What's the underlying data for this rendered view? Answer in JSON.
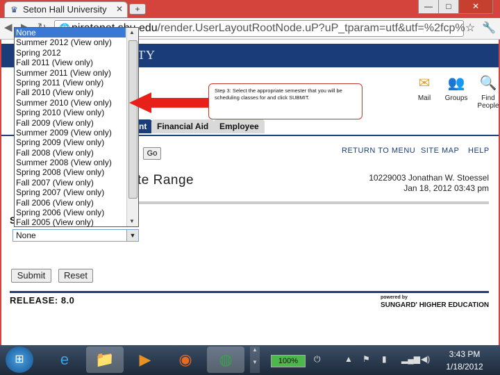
{
  "browser": {
    "tab_title": "Seton Hall University",
    "tab_close": "✕",
    "new_tab": "+",
    "window_controls": {
      "minimize": "—",
      "maximize": "□",
      "close": "✕"
    },
    "address": {
      "host_part": "piratenet.shu.edu",
      "path_part": "/render.UserLayoutRootNode.uP?uP_tparam=utf&utf=%2fcp%"
    },
    "icons": {
      "back": "back-icon",
      "forward": "forward-icon",
      "reload": "reload-icon",
      "page": "page-icon",
      "wrench": "wrench-icon"
    }
  },
  "page": {
    "banner_text": "TY",
    "top_icons": [
      {
        "label": "Mail",
        "icon": "mail-icon",
        "color": "#e8a21e"
      },
      {
        "label": "Groups",
        "icon": "groups-icon",
        "color": "#2a5db0"
      },
      {
        "label": "Find People",
        "icon": "find-icon",
        "color": "#3a9a3a"
      }
    ],
    "nav_tabs": [
      {
        "label": "nt",
        "active": true
      },
      {
        "label": "Financial Aid",
        "active": false
      },
      {
        "label": "Employee",
        "active": false
      }
    ],
    "go_button": "Go",
    "links": {
      "return_to_menu": "RETURN TO MENU",
      "site_map": "SITE MAP",
      "help": "HELP"
    },
    "heading": "te Range",
    "user_id_name": "10229003 Jonathan W. Stoessel",
    "timestamp": "Jan 18, 2012 03:43 pm",
    "section_letter": "S",
    "term_select": {
      "selected": "None"
    },
    "submit_button": "Submit",
    "reset_button": "Reset",
    "release": "RELEASE: 8.0",
    "powered_by": "powered by",
    "vendor": "SUNGARD' HIGHER EDUCATION"
  },
  "dropdown": {
    "options": [
      "None",
      "Summer 2012 (View only)",
      "Spring 2012",
      "Fall 2011 (View only)",
      "Summer 2011 (View only)",
      "Spring 2011 (View only)",
      "Fall 2010 (View only)",
      "Summer 2010 (View only)",
      "Spring 2010 (View only)",
      "Fall 2009 (View only)",
      "Summer 2009 (View only)",
      "Spring 2009 (View only)",
      "Fall 2008 (View only)",
      "Summer 2008 (View only)",
      "Spring 2008 (View only)",
      "Fall 2007 (View only)",
      "Spring 2007 (View only)",
      "Fall 2006 (View only)",
      "Spring 2006 (View only)",
      "Fall 2005 (View only)"
    ],
    "selected_index": 0
  },
  "callout": {
    "text": "Step 3: Select the appropriate semester that you will be scheduling classes for and click SUBMIT."
  },
  "taskbar": {
    "apps": [
      {
        "icon": "ie-icon",
        "active": false
      },
      {
        "icon": "explorer-icon",
        "active": true
      },
      {
        "icon": "media-player-icon",
        "active": false
      },
      {
        "icon": "firefox-icon",
        "active": false
      },
      {
        "icon": "chrome-icon",
        "active": true
      }
    ],
    "battery": "100%",
    "time": "3:43 PM",
    "date": "1/18/2012"
  },
  "colors": {
    "frame": "#d4443c",
    "banner": "#1a3d7a",
    "selection": "#3a78d6",
    "arrow": "#e8201a"
  }
}
